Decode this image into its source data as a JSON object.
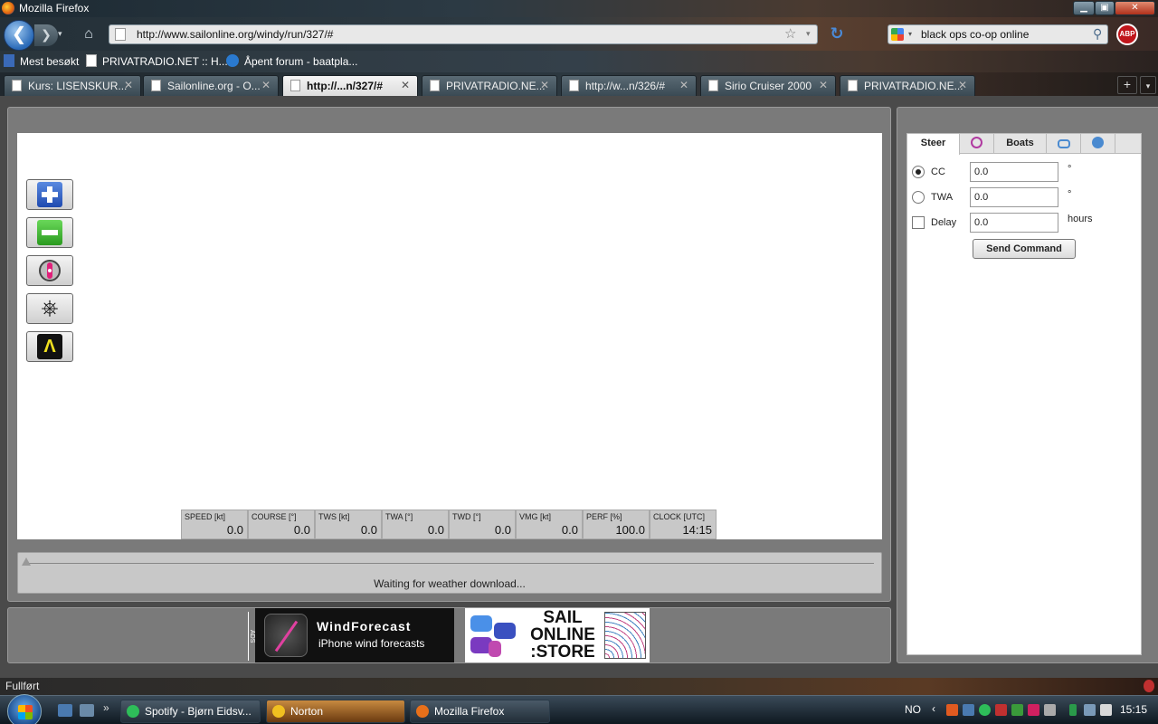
{
  "window": {
    "title": "Mozilla Firefox",
    "minimize": "▁",
    "maximize": "▣",
    "close": "✕"
  },
  "navbar": {
    "back": "❮",
    "forward": "❯",
    "history": "▾",
    "home": "⌂",
    "url": "http://www.sailonline.org/windy/run/327/#",
    "bookmark_star": "☆",
    "url_dropdown": "▾",
    "reload": "↻",
    "search_query": "black ops co-op online",
    "search_dropdown": "▾",
    "search_button": "⚲",
    "abp_label": "ABP"
  },
  "bookmarks": [
    {
      "label": "Mest besøkt",
      "icon": "most-visited-icon"
    },
    {
      "label": "PRIVATRADIO.NET :: H...",
      "icon": "page-icon"
    },
    {
      "label": "Åpent forum - baatpla...",
      "icon": "forum-icon"
    }
  ],
  "tabs": [
    {
      "label": "Kurs: LISENSKUR...",
      "active": false
    },
    {
      "label": "Sailonline.org - O...",
      "active": false
    },
    {
      "label": "http://...n/327/#",
      "active": true
    },
    {
      "label": "PRIVATRADIO.NE...",
      "active": false
    },
    {
      "label": "http://w...n/326/#",
      "active": false
    },
    {
      "label": "Sirio Cruiser 2000",
      "active": false
    },
    {
      "label": "PRIVATRADIO.NE...",
      "active": false
    }
  ],
  "tab_close": "✕",
  "tab_new": "+",
  "tab_list": "▾",
  "map_tools": [
    {
      "name": "zoom-in",
      "icon": "zoom-in-icon"
    },
    {
      "name": "zoom-out",
      "icon": "zoom-out-icon"
    },
    {
      "name": "center-boat",
      "icon": "center-boat-icon"
    },
    {
      "name": "helm",
      "icon": "helm-icon",
      "glyph": "⎈"
    },
    {
      "name": "measure",
      "icon": "compass-icon",
      "glyph": "Ʌ"
    }
  ],
  "instruments": [
    {
      "label": "SPEED [kt]",
      "value": "0.0"
    },
    {
      "label": "COURSE [°]",
      "value": "0.0"
    },
    {
      "label": "TWS [kt]",
      "value": "0.0"
    },
    {
      "label": "TWA [°]",
      "value": "0.0"
    },
    {
      "label": "TWD [°]",
      "value": "0.0"
    },
    {
      "label": "VMG [kt]",
      "value": "0.0"
    },
    {
      "label": "PERF [%]",
      "value": "100.0"
    },
    {
      "label": "CLOCK [UTC]",
      "value": "14:15"
    }
  ],
  "timeline": {
    "status": "Waiting for weather download...",
    "position": 0
  },
  "ads": {
    "label": "ADS",
    "windforecast_title": "WindForecast",
    "windforecast_sub": "iPhone wind forecasts",
    "store_text": "SAIL ONLINE :STORE"
  },
  "side_panel": {
    "tabs": [
      {
        "label": "Steer",
        "active": true
      },
      {
        "label": "",
        "icon": "compass-tab-icon"
      },
      {
        "label": "Boats",
        "active": false
      },
      {
        "label": "",
        "icon": "chat-icon"
      },
      {
        "label": "",
        "icon": "help-icon"
      }
    ],
    "cc": {
      "label": "CC",
      "value": "0.0",
      "unit": "°",
      "selected": true
    },
    "twa": {
      "label": "TWA",
      "value": "0.0",
      "unit": "°",
      "selected": false
    },
    "delay": {
      "label": "Delay",
      "value": "0.0",
      "unit": "hours",
      "checked": false
    },
    "send_label": "Send Command"
  },
  "statusbar": {
    "text": "Fullført"
  },
  "taskbar": {
    "more": "»",
    "tasks": [
      {
        "label": "Spotify - Bjørn Eidsv...",
        "color": "#2ebd59"
      },
      {
        "label": "Norton",
        "color": "#f0c020",
        "highlight": true
      },
      {
        "label": "Mozilla Firefox",
        "color": "#e8701a"
      }
    ],
    "lang": "NO",
    "tray_arrow": "‹",
    "clock": "15:15"
  }
}
